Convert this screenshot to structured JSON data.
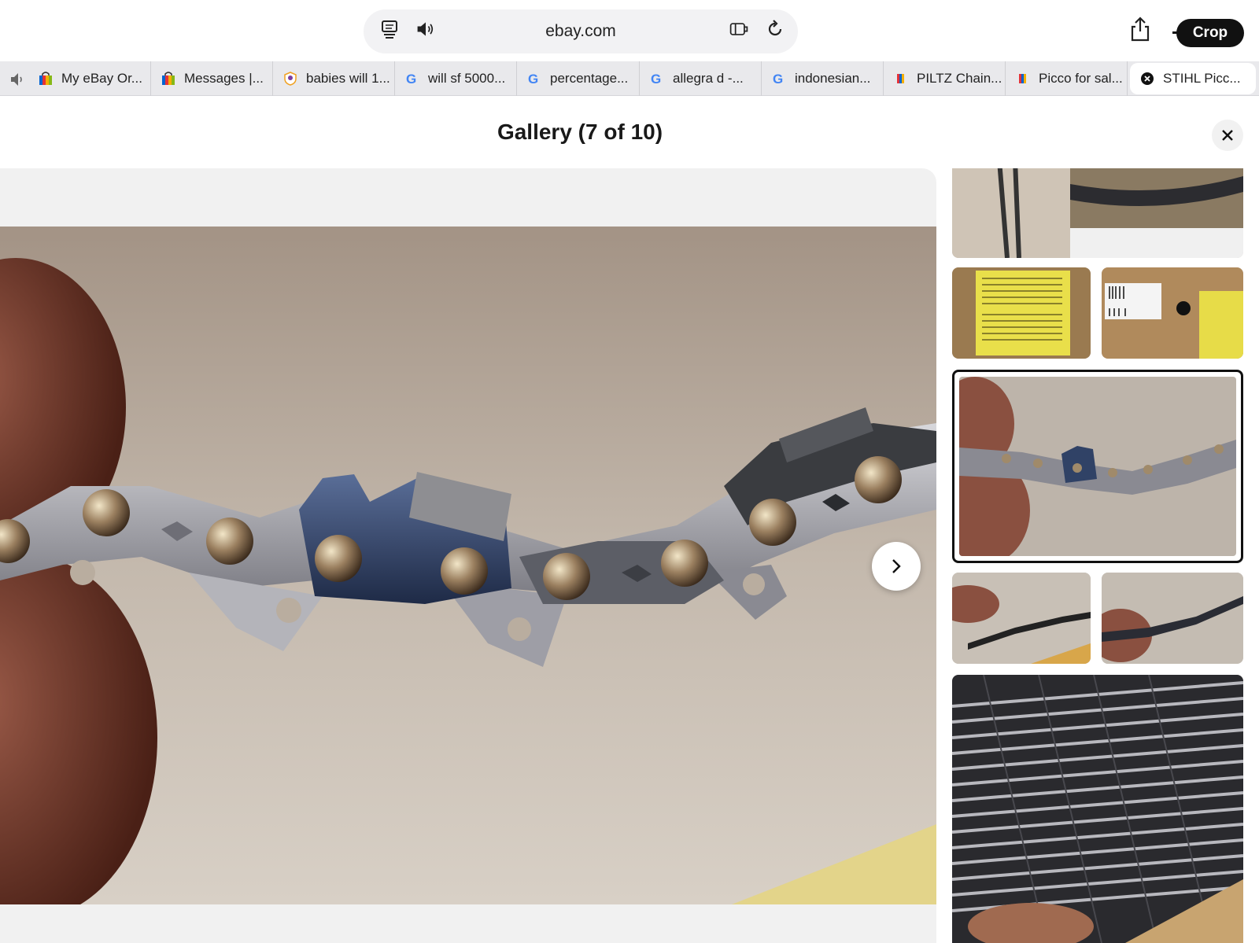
{
  "browser": {
    "url": "ebay.com",
    "crop_label": "Crop",
    "icons": [
      "reader-icon",
      "speaker-icon",
      "extension-icon",
      "reload-icon",
      "share-icon"
    ]
  },
  "tabs": [
    {
      "label": "My eBay Or...",
      "icon": "ebay-bag-icon"
    },
    {
      "label": "Messages |...",
      "icon": "ebay-bag-icon"
    },
    {
      "label": "babies will 1...",
      "icon": "shield-icon"
    },
    {
      "label": "will sf 5000...",
      "icon": "google-icon"
    },
    {
      "label": "percentage...",
      "icon": "google-icon"
    },
    {
      "label": "allegra d -...",
      "icon": "google-icon"
    },
    {
      "label": "indonesian...",
      "icon": "google-icon"
    },
    {
      "label": "PILTZ Chain...",
      "icon": "ebay-tag-icon"
    },
    {
      "label": "Picco for sal...",
      "icon": "ebay-tag-icon"
    },
    {
      "label": "STIHL Picc...",
      "icon": "close-tab-icon",
      "active": true
    }
  ],
  "gallery": {
    "title": "Gallery (7 of 10)",
    "current_index": 7,
    "total": 10
  },
  "colors": {
    "accent_dark": "#111111",
    "viewer_bg": "#f1f1f1",
    "tabbar_bg": "#e9e9ec"
  }
}
